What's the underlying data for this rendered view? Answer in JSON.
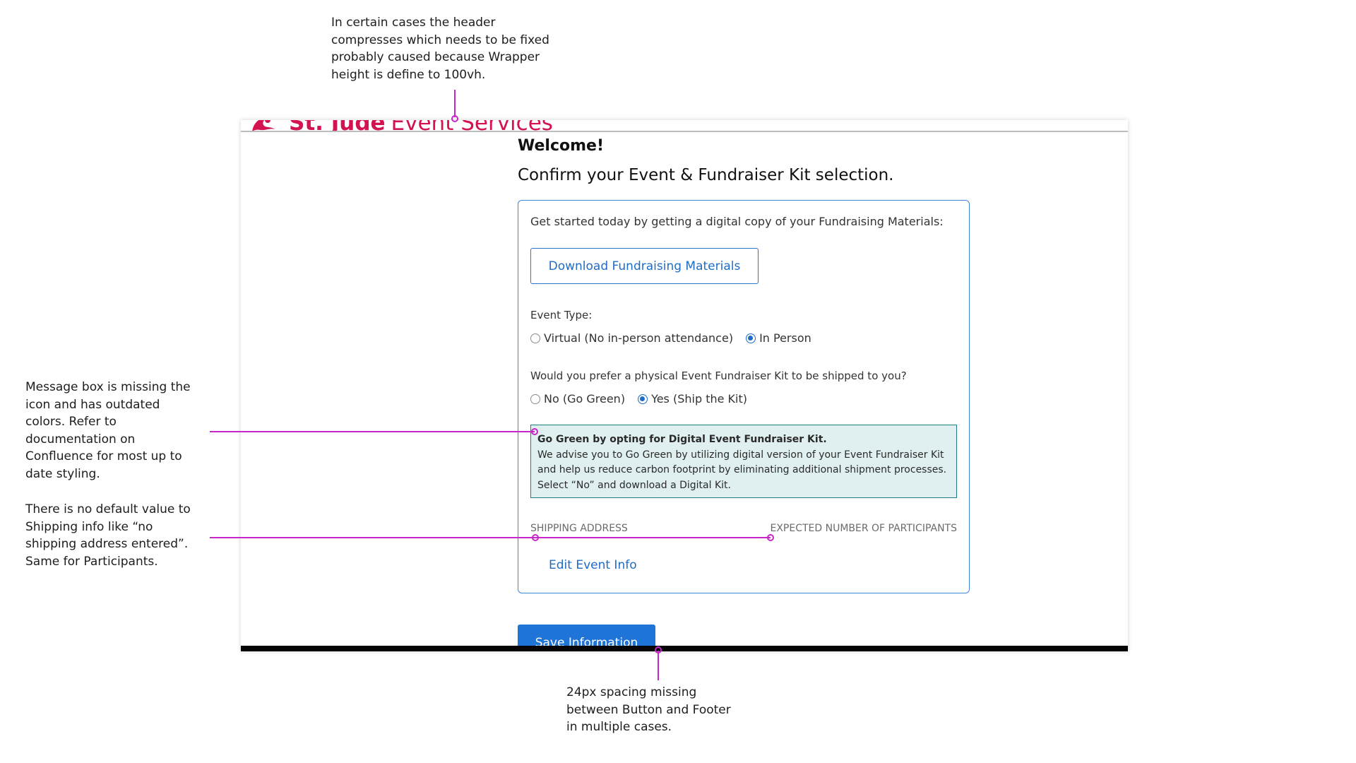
{
  "annotations": {
    "header_note": "In certain cases the header\ncompresses which needs to be fixed\nprobably caused because Wrapper\nheight is define to 100vh.",
    "message_note": "Message box is missing the\nicon and has outdated\ncolors. Refer to\ndocumentation on\nConfluence for most up to\ndate styling.",
    "shipping_note": "There is no default value to\nShipping info like “no\nshipping address entered”.\nSame for Participants.",
    "spacing_note": "24px spacing missing\nbetween Button and Footer\nin multiple cases.",
    "line_color": "#c627c8"
  },
  "header": {
    "brand_bold": "St. Jude",
    "brand_rest": "Event Services",
    "brand_color": "#d3134f",
    "logo_icon": "st-jude-logo-icon"
  },
  "main": {
    "welcome": "Welcome!",
    "confirm": "Confirm your Event & Fundraiser Kit selection.",
    "intro": "Get started today by getting a digital copy of your Fundraising Materials:",
    "download_label": "Download Fundraising Materials",
    "event_type_label": "Event Type:",
    "event_type_options": [
      {
        "label": "Virtual (No in-person attendance)",
        "selected": false
      },
      {
        "label": "In Person",
        "selected": true
      }
    ],
    "kit_question": "Would you prefer a physical Event Fundraiser Kit to be shipped to you?",
    "kit_options": [
      {
        "label": "No (Go Green)",
        "selected": false
      },
      {
        "label": "Yes (Ship the Kit)",
        "selected": true
      }
    ],
    "message": {
      "title": "Go Green by opting for Digital Event Fundraiser Kit.",
      "body": "We advise you to Go Green by utilizing digital version of your Event Fundraiser Kit\nand help us reduce carbon footprint by eliminating additional shipment processes.\nSelect “No” and download a Digital Kit."
    },
    "shipping_label": "SHIPPING ADDRESS",
    "participants_label": "EXPECTED NUMBER OF PARTICIPANTS",
    "edit_link": "Edit Event Info",
    "save_label": "Save Information"
  },
  "colors": {
    "accent": "#1f6cc6",
    "primary_button": "#1f74d8",
    "message_bg": "#e0f0f1",
    "message_border": "#1f7d83",
    "footer": "#050505"
  }
}
